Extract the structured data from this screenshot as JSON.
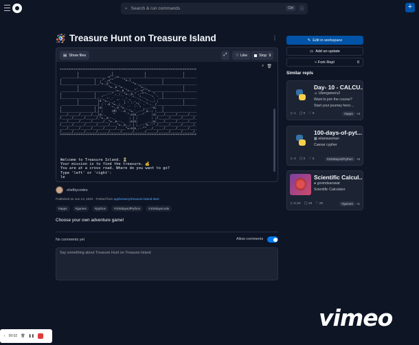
{
  "topbar": {
    "search_placeholder": "Search & run commands",
    "kbd1": "Ctrl",
    "kbd2": ".",
    "new_label": "+"
  },
  "repl": {
    "title_emoji": "🪅",
    "title": "Treasure Hunt on Treasure Island",
    "show_files": "Show files",
    "like": "Like",
    "stop": "Stop",
    "stop_count": "9"
  },
  "terminal": {
    "ascii": "*******************************************************************************\n          |                   |                  |                     |\n _________|________________.=\"\"_;=.______________|_____________________|_______\n|                   |  ,-\"_,=\"\"     `\"=.|                  |\n|___________________|__\"=._o`\"-._        `\"=.______________|___________________\n          |                `\"=._o`\"=._      _`\"=._                     |\n _________|_____________________:=._o \"=._.\"_.-=\"'\"=.__________________|_______\n|                   |    __.--\" , ; `\"=._o.\" ,-\"\"\"-._ \".   |\n|___________________|_._\"  ,. .` ` `` ,  `\"-._\"-._   \". '__|___________________\n          |           |o`\"=._` , \"` `; .\". ,  \"-._\"-._; ;              |\n _________|___________| ;`-.o`\"=._; .\" ` '`.\"\\` . \"-._ /_______________|_______\n|                   | |o;    `\"-.o`\"=._``  '` \" ,__.--o;   |\n|___________________|_| ;     (#) `-.o `\"=.`_.--\"_o.-; ;___|___________________\n____/______/______/___|o;._    \"      `\".o|o_.--\"    ;o;____/______/______/____\n/______/______/______/_\"=._o--._        ; | ;        ; ;/______/______/______/_\n____/______/______/______/__\"=._o--._   ;o|o;     _._;o;____/______/______/____\n/______/______/______/______/____\"=._o._; | ;_.--\"o.--\"_/______/______/______/_\n____/______/______/______/______/_____\"=.o|o_.--\"\"___/______/______/______/____\n/______/______/______/______/______/______/______/______/______/______/______/_\n*******************************************************************************",
    "line1": "Welcome to Treasure Island. ⏳",
    "line2": "Your mission is to find the treasure. 💰",
    "line3": "You are at a cross road. Where do you want to go?",
    "line4": "Type 'left' or 'right':",
    "line5": "le"
  },
  "author": {
    "name": "shelbycodes",
    "published": "Published on Jun 13, 2022 · Forked from",
    "forked_from": "appbrewery/treasure-island-start"
  },
  "tags": [
    "#apps",
    "#games",
    "#python",
    "#100daysofPython",
    "#100dayscode"
  ],
  "description": "Choose your own adventure game!",
  "comments": {
    "none_label": "No comments yet",
    "allow_label": "Allow comments",
    "allow_enabled": true,
    "placeholder": "Say something about Treasure Hunt on Treasure Island"
  },
  "sidebar": {
    "edit": "Edit in workspace",
    "update": "Add an update",
    "fork": "Fork Repl",
    "fork_count": "0",
    "similar_heading": "Similar repls",
    "cards": [
      {
        "title": "Day- 10 - CALCU...",
        "user": "Ubergamerx2",
        "desc1": "Want to join the course?",
        "desc2": "Start your journey here:...",
        "runs": "1",
        "comments": "0",
        "likes": "5",
        "tag": "#apps",
        "more": "+3"
      },
      {
        "title": "100-days-of-pyt...",
        "user": "eitanwaxman",
        "desc1": "Caesar cypher",
        "desc2": "",
        "runs": "3",
        "comments": "0",
        "likes": "6",
        "tag": "#100daysofPython",
        "more": "+3"
      },
      {
        "title": "Scientific Calcul...",
        "user": "govindsarswat",
        "desc1": "Scientific Calculator",
        "desc2": "",
        "runs": "5.2K",
        "comments": "18",
        "likes": "29",
        "tag": "#games",
        "more": "+1"
      }
    ]
  },
  "player": {
    "time": "00:02"
  },
  "watermark": "vimeo"
}
